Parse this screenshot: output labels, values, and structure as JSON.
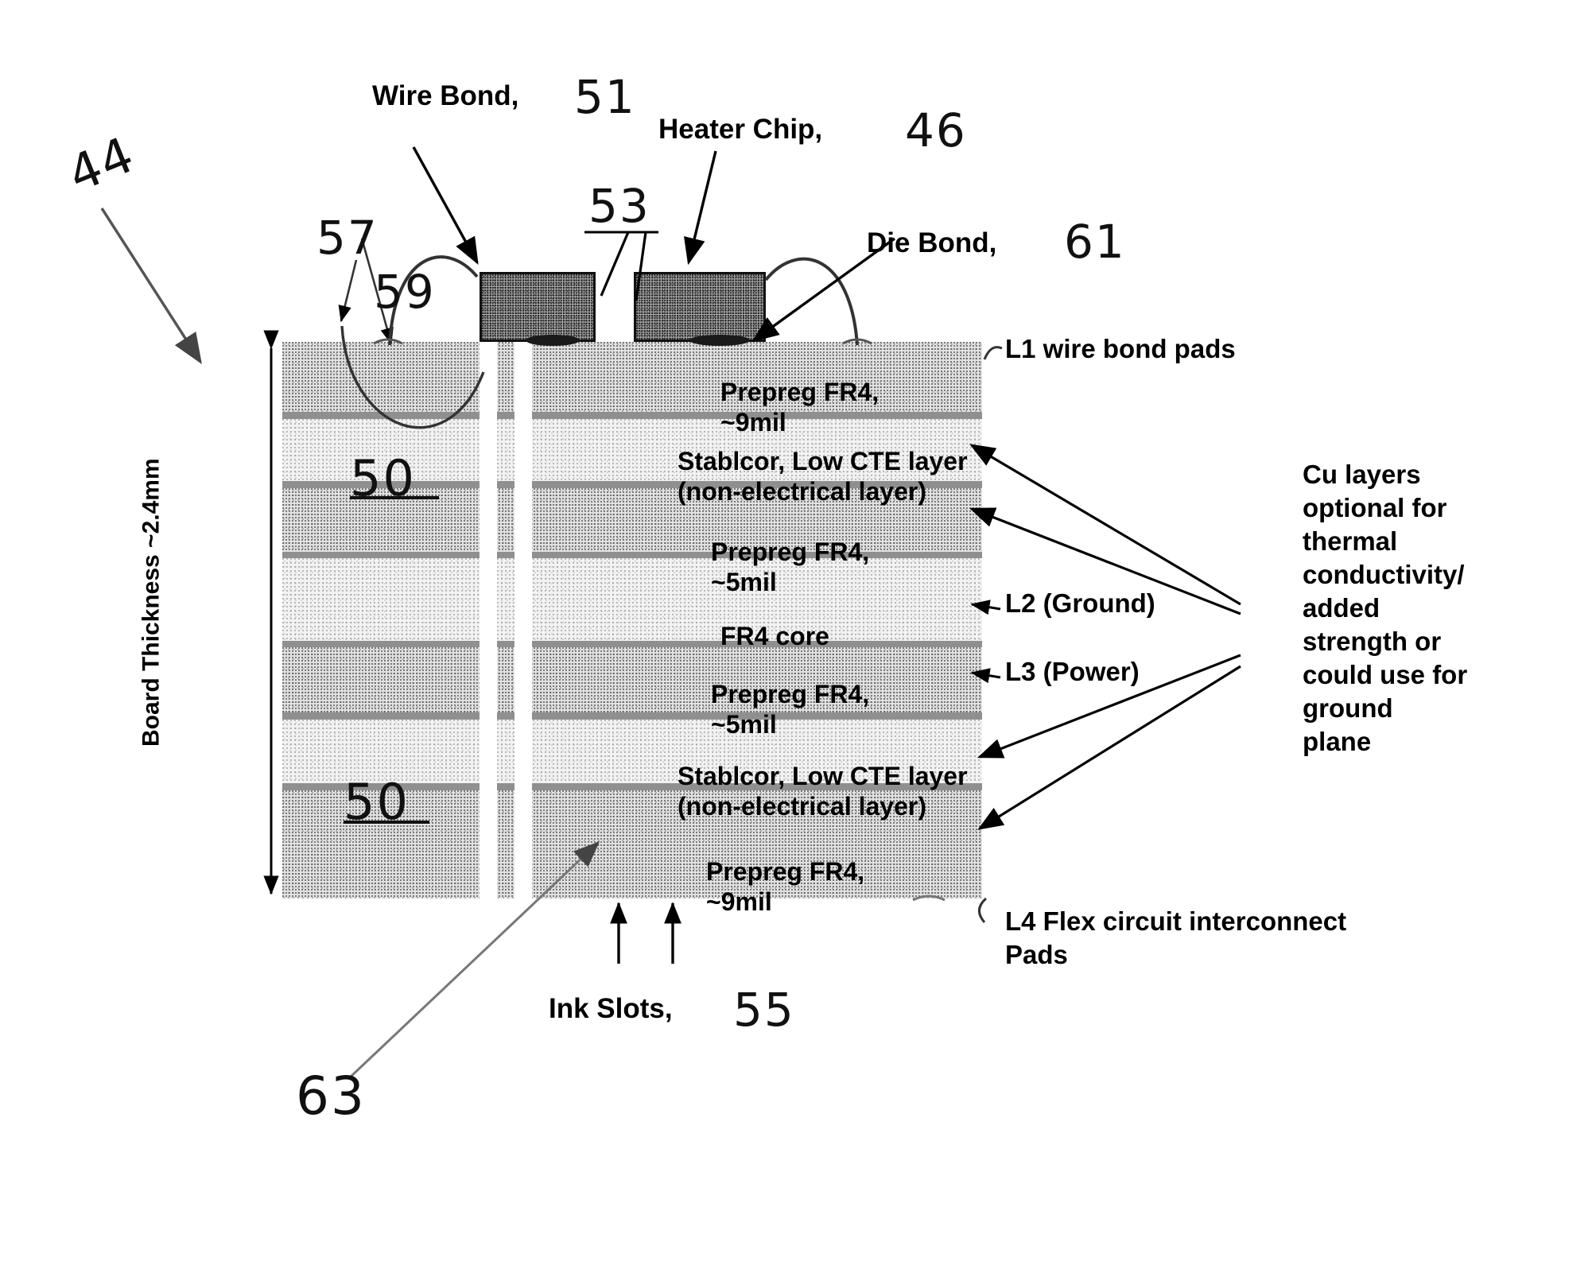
{
  "figure": {
    "type": "patent-cross-section-diagram",
    "subject": "Inkjet printhead heater chip mounted on multilayer FR4 board"
  },
  "callouts": {
    "wire_bond": {
      "text": "Wire Bond,",
      "ref": "51"
    },
    "heater_chip": {
      "text": "Heater Chip,",
      "ref": "46"
    },
    "die_bond": {
      "text": "Die Bond,",
      "ref": "61"
    },
    "ink_slots": {
      "text": "Ink Slots,",
      "ref": "55"
    }
  },
  "ref_numerals": {
    "assembly": "44",
    "board_top_surface": "57",
    "wire_bond_loop": "59",
    "chip_slot": "53",
    "copper_layer_a": "50",
    "copper_layer_b": "50",
    "board_body": "63"
  },
  "dimension": {
    "board_thickness": "Board Thickness ~2.4mm"
  },
  "stack_labels": [
    {
      "id": "prepreg-9mil-top",
      "line1": "Prepreg FR4,",
      "line2": "~9mil"
    },
    {
      "id": "stablcor-top",
      "line1": "Stablcor, Low CTE layer",
      "line2": "(non-electrical layer)"
    },
    {
      "id": "prepreg-5mil-top",
      "line1": "Prepreg FR4,",
      "line2": "~5mil"
    },
    {
      "id": "fr4-core",
      "line1": "FR4 core",
      "line2": ""
    },
    {
      "id": "prepreg-5mil-bot",
      "line1": "Prepreg FR4,",
      "line2": "~5mil"
    },
    {
      "id": "stablcor-bot",
      "line1": "Stablcor, Low CTE layer",
      "line2": "(non-electrical layer)"
    },
    {
      "id": "prepreg-9mil-bot",
      "line1": "Prepreg FR4,",
      "line2": "~9mil"
    }
  ],
  "layer_callouts": {
    "l1": "L1 wire bond pads",
    "l2": "L2 (Ground)",
    "l3": "L3 (Power)",
    "l4_line1": "L4 Flex circuit interconnect",
    "l4_line2": "Pads"
  },
  "cu_note": {
    "lines": [
      "Cu layers",
      "optional for",
      "thermal",
      "conductivity/",
      "added",
      "strength or",
      "could use for",
      "ground",
      "plane"
    ]
  },
  "colors": {
    "ink": "#000000",
    "paper": "#ffffff",
    "copper_band": "#8f8f8f",
    "chip_fill": "#b0b0b0",
    "prepreg_fill": "#e2e2e2",
    "core_fill": "#f2f2f2"
  }
}
